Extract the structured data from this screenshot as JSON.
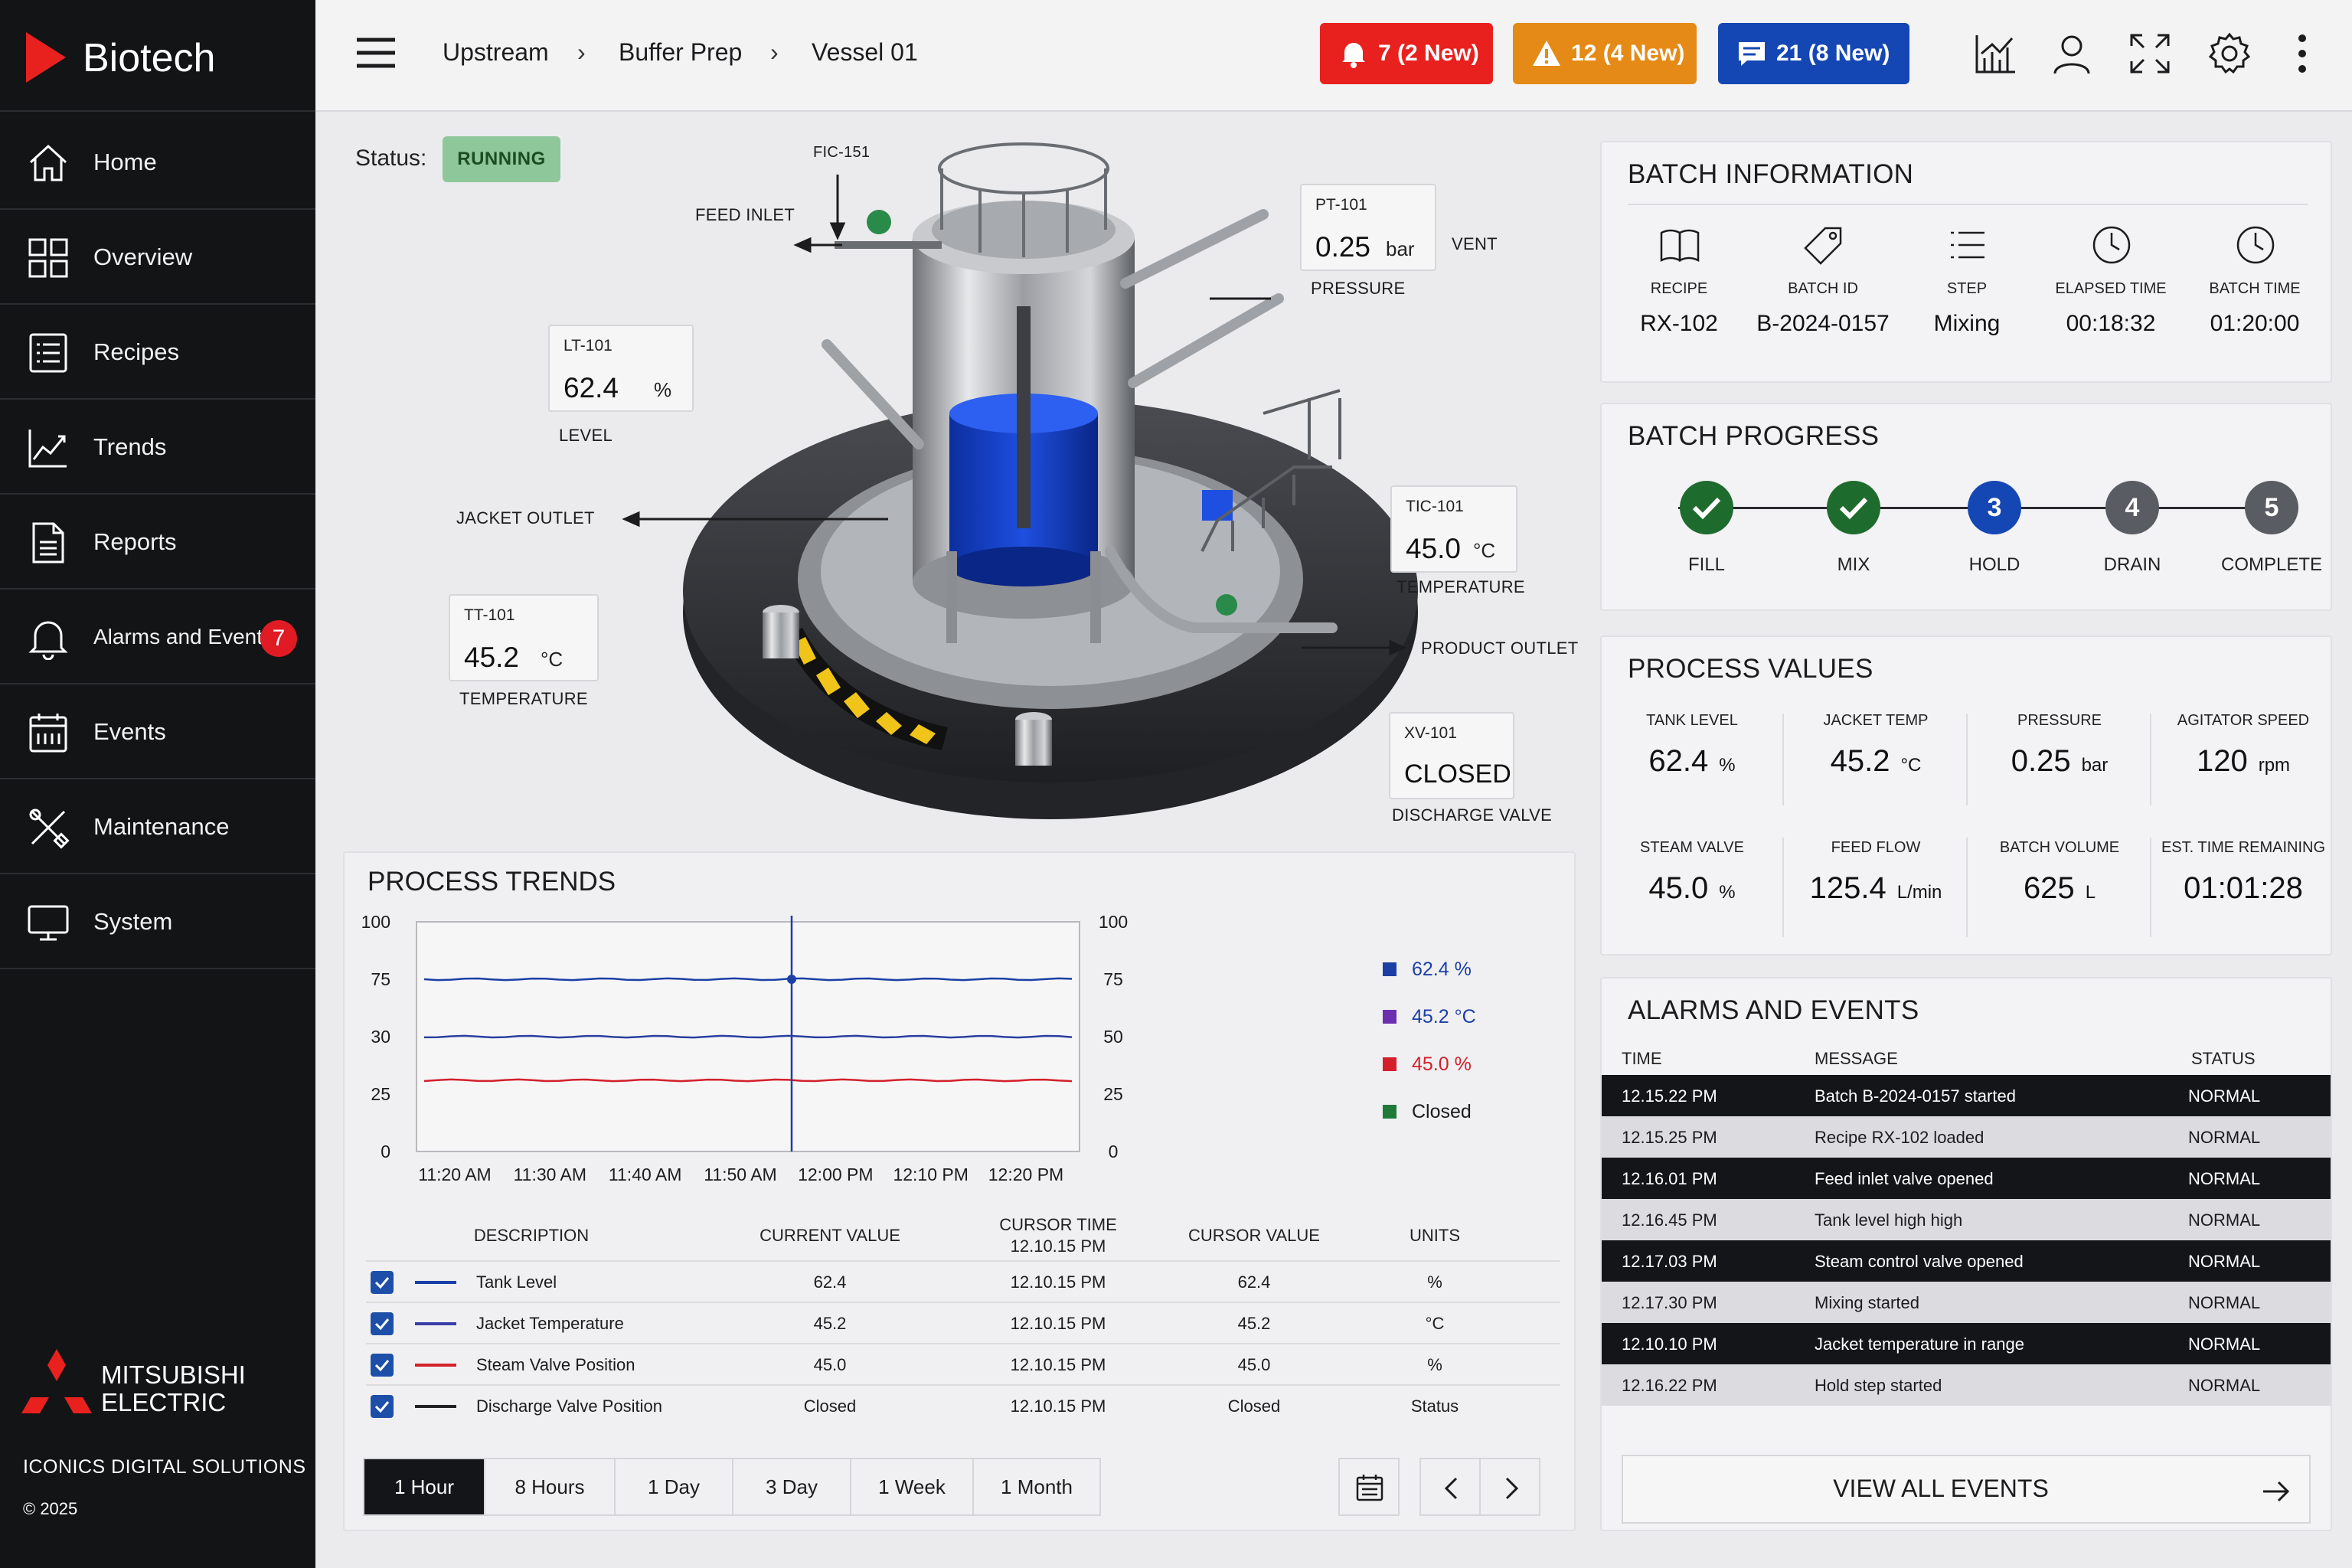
{
  "app": {
    "name": "Biotech"
  },
  "sidebar": {
    "items": [
      {
        "label": "Home",
        "icon": "home-icon"
      },
      {
        "label": "Overview",
        "icon": "grid-icon"
      },
      {
        "label": "Recipes",
        "icon": "list-icon"
      },
      {
        "label": "Trends",
        "icon": "trend-icon"
      },
      {
        "label": "Reports",
        "icon": "document-icon"
      },
      {
        "label": "Alarms and Events",
        "icon": "bell-icon",
        "badge": "7"
      },
      {
        "label": "Events",
        "icon": "calendar-icon"
      },
      {
        "label": "Maintenance",
        "icon": "tools-icon"
      },
      {
        "label": "System",
        "icon": "monitor-icon"
      }
    ],
    "footer": {
      "logo_line1": "MITSUBISHI",
      "logo_line2": "ELECTRIC",
      "company": "ICONICS DIGITAL SOLUTIONS",
      "copyright": "© 2025"
    }
  },
  "header": {
    "breadcrumb": [
      "Upstream",
      "Buffer Prep",
      "Vessel 01"
    ],
    "alarms": [
      {
        "label": "7 (2 New)",
        "color": "#e8211f",
        "icon": "bell-icon"
      },
      {
        "label": "12 (4 New)",
        "color": "#e58a16",
        "icon": "warning-icon"
      },
      {
        "label": "21 (8 New)",
        "color": "#1447b3",
        "icon": "message-icon"
      }
    ]
  },
  "vessel": {
    "status_label": "Status:",
    "status_value": "RUNNING",
    "tags": {
      "fic": {
        "id": "FIC-151",
        "label": "FEED INLET"
      },
      "pt": {
        "id": "PT-101",
        "value": "0.25",
        "unit": "bar",
        "label": "PRESSURE",
        "side_label": "VENT"
      },
      "lt": {
        "id": "LT-101",
        "value": "62.4",
        "unit": "%",
        "label": "LEVEL"
      },
      "tic": {
        "id": "TIC-101",
        "value": "45.0",
        "unit": "°C",
        "label": "TEMPERATURE"
      },
      "tt": {
        "id": "TT-101",
        "value": "45.2",
        "unit": "°C",
        "label": "TEMPERATURE"
      },
      "xv": {
        "id": "XV-101",
        "value": "CLOSED",
        "label": "DISCHARGE VALVE"
      },
      "jacket_outlet": "JACKET OUTLET",
      "product_outlet": "PRODUCT OUTLET"
    }
  },
  "trends": {
    "title": "PROCESS TRENDS",
    "legend": [
      {
        "label": "62.4 %",
        "color": "#1c3fa6"
      },
      {
        "label": "45.2 °C",
        "color": "#6b2fb0"
      },
      {
        "label": "45.0 %",
        "color": "#d3202a"
      },
      {
        "label": "Closed",
        "color": "#1f7a3a"
      }
    ],
    "table": {
      "headers": {
        "description": "DESCRIPTION",
        "current": "CURRENT VALUE",
        "cursor_time": "CURSOR TIME",
        "cursor_time_sub": "12.10.15 PM",
        "cursor_value": "CURSOR VALUE",
        "units": "UNITS"
      },
      "rows": [
        {
          "description": "Tank Level",
          "current": "62.4",
          "cursor_time": "12.10.15 PM",
          "cursor_value": "62.4",
          "units": "%",
          "color": "#1c3fa6"
        },
        {
          "description": "Jacket Temperature",
          "current": "45.2",
          "cursor_time": "12.10.15 PM",
          "cursor_value": "45.2",
          "units": "°C",
          "color": "#3a3fa6"
        },
        {
          "description": "Steam Valve Position",
          "current": "45.0",
          "cursor_time": "12.10.15 PM",
          "cursor_value": "45.0",
          "units": "%",
          "color": "#d3202a"
        },
        {
          "description": "Discharge Valve Position",
          "current": "Closed",
          "cursor_time": "12.10.15 PM",
          "cursor_value": "Closed",
          "units": "Status",
          "color": "#222222"
        }
      ]
    },
    "ranges": [
      "1 Hour",
      "8 Hours",
      "1 Day",
      "3 Day",
      "1 Week",
      "1 Month"
    ],
    "active_range": "1 Hour"
  },
  "chart_data": {
    "type": "line",
    "title": "PROCESS TRENDS",
    "x": [
      "11:20 AM",
      "11:30 AM",
      "11:40 AM",
      "11:50 AM",
      "12:00 PM",
      "12:10 PM",
      "12:20 PM"
    ],
    "y_ticks_left": [
      "100",
      "75",
      "30",
      "25",
      "0"
    ],
    "y_ticks_right": [
      "100",
      "75",
      "50",
      "25",
      "0"
    ],
    "ylim": [
      0,
      100
    ],
    "cursor_x": "12:10 PM",
    "grid": false,
    "series": [
      {
        "name": "62.4 %",
        "color": "#1c3fa6",
        "values": [
          75,
          75,
          75,
          75,
          75,
          75,
          75
        ]
      },
      {
        "name": "45.2 °C",
        "color": "#2a3fa0",
        "values": [
          50,
          50,
          50,
          50,
          50,
          50,
          50
        ]
      },
      {
        "name": "45.0 %",
        "color": "#d3202a",
        "values": [
          31,
          31,
          31,
          31,
          31,
          31,
          31
        ]
      }
    ]
  },
  "batch_info": {
    "title": "BATCH INFORMATION",
    "items": [
      {
        "label": "RECIPE",
        "value": "RX-102",
        "icon": "book-icon"
      },
      {
        "label": "BATCH ID",
        "value": "B-2024-0157",
        "icon": "tag-icon"
      },
      {
        "label": "STEP",
        "value": "Mixing",
        "icon": "list-icon"
      },
      {
        "label": "ELAPSED TIME",
        "value": "00:18:32",
        "icon": "clock-icon"
      },
      {
        "label": "BATCH TIME",
        "value": "01:20:00",
        "icon": "clock-icon"
      }
    ]
  },
  "batch_progress": {
    "title": "BATCH PROGRESS",
    "steps": [
      {
        "label": "FILL",
        "state": "done",
        "number": "1",
        "color": "#1e6b2e"
      },
      {
        "label": "MIX",
        "state": "done",
        "number": "2",
        "color": "#1e6b2e"
      },
      {
        "label": "HOLD",
        "state": "active",
        "number": "3",
        "color": "#1447b3"
      },
      {
        "label": "DRAIN",
        "state": "pending",
        "number": "4",
        "color": "#5a5c63"
      },
      {
        "label": "COMPLETE",
        "state": "pending",
        "number": "5",
        "color": "#5a5c63"
      }
    ]
  },
  "process_values": {
    "title": "PROCESS VALUES",
    "items": [
      {
        "label": "TANK LEVEL",
        "value": "62.4",
        "unit": "%"
      },
      {
        "label": "JACKET TEMP",
        "value": "45.2",
        "unit": "°C"
      },
      {
        "label": "PRESSURE",
        "value": "0.25",
        "unit": "bar"
      },
      {
        "label": "AGITATOR SPEED",
        "value": "120",
        "unit": "rpm"
      },
      {
        "label": "STEAM VALVE",
        "value": "45.0",
        "unit": "%"
      },
      {
        "label": "FEED FLOW",
        "value": "125.4",
        "unit": "L/min"
      },
      {
        "label": "BATCH VOLUME",
        "value": "625",
        "unit": "L"
      },
      {
        "label": "EST. TIME REMAINING",
        "value": "01:01:28",
        "unit": ""
      }
    ]
  },
  "alarms_events": {
    "title": "ALARMS AND EVENTS",
    "headers": {
      "time": "TIME",
      "message": "MESSAGE",
      "status": "STATUS"
    },
    "rows": [
      {
        "time": "12.15.22 PM",
        "message": "Batch B-2024-0157 started",
        "status": "NORMAL"
      },
      {
        "time": "12.15.25 PM",
        "message": "Recipe RX-102 loaded",
        "status": "NORMAL"
      },
      {
        "time": "12.16.01 PM",
        "message": "Feed inlet valve opened",
        "status": "NORMAL"
      },
      {
        "time": "12.16.45 PM",
        "message": "Tank level high high",
        "status": "NORMAL"
      },
      {
        "time": "12.17.03 PM",
        "message": "Steam control valve opened",
        "status": "NORMAL"
      },
      {
        "time": "12.17.30 PM",
        "message": "Mixing started",
        "status": "NORMAL"
      },
      {
        "time": "12.10.10 PM",
        "message": "Jacket temperature in range",
        "status": "NORMAL"
      },
      {
        "time": "12.16.22 PM",
        "message": "Hold step started",
        "status": "NORMAL"
      }
    ],
    "view_all": "VIEW ALL EVENTS"
  }
}
